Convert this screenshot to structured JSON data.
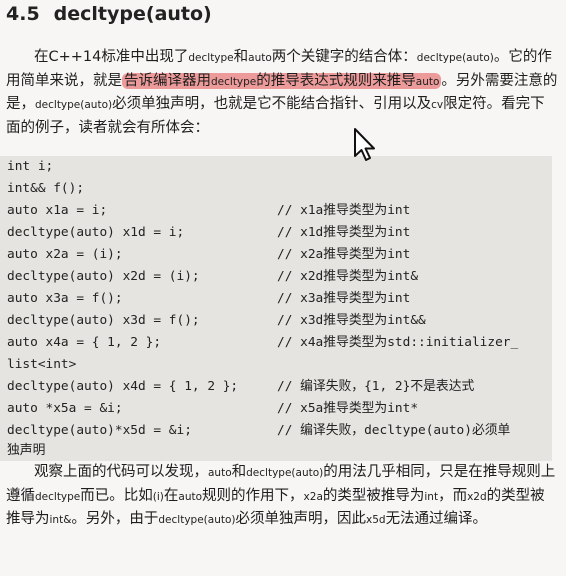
{
  "heading": {
    "number": "4.5",
    "title": "decltype(auto)"
  },
  "para1": {
    "s1": "在C++14标准中出现了",
    "s2": "decltype",
    "s3": "和",
    "s4": "auto",
    "s5": "两个关键字的结合体：",
    "s6": "decltype(auto)",
    "s7": "。它的作用简单来说，就是",
    "hl1": "告诉编译器用",
    "hl2": "decltype",
    "hl3": "的推导表达式规则来推导",
    "hl4": "auto",
    "s8": "。另外需要注意的是，",
    "s9": "decltype(auto)",
    "s10": "必须单独声明，也就是它不能结合指针、引用以及",
    "s11": "cv",
    "s12": "限定符。看完下面的例子，读者就会有所体会："
  },
  "code": [
    {
      "code": "int i;",
      "comment": ""
    },
    {
      "code": "int&& f();",
      "comment": ""
    },
    {
      "code": "auto x1a = i;",
      "comment": "// x1a推导类型为int"
    },
    {
      "code": "decltype(auto) x1d = i;",
      "comment": "// x1d推导类型为int"
    },
    {
      "code": "auto x2a = (i);",
      "comment": "// x2a推导类型为int"
    },
    {
      "code": "decltype(auto) x2d = (i);",
      "comment": "// x2d推导类型为int&"
    },
    {
      "code": "auto x3a = f();",
      "comment": "// x3a推导类型为int"
    },
    {
      "code": "decltype(auto) x3d = f();",
      "comment": "// x3d推导类型为int&&"
    },
    {
      "code": "auto x4a = { 1, 2 };",
      "comment": "// x4a推导类型为std::initializer_"
    },
    {
      "code": "list<int>",
      "comment": ""
    },
    {
      "code": "decltype(auto) x4d = { 1, 2 };",
      "comment": "// 编译失败，{1, 2}不是表达式"
    },
    {
      "code": "auto *x5a = &i;",
      "comment": "// x5a推导类型为int*"
    },
    {
      "code": "decltype(auto)*x5d = &i;",
      "comment": "// 编译失败，decltype(auto)必须单"
    },
    {
      "code": "独声明",
      "comment": ""
    }
  ],
  "para2": {
    "s1": "观察上面的代码可以发现，",
    "s2": "auto",
    "s3": "和",
    "s4": "decltype(auto)",
    "s5": "的用法几乎相同，只是在推导规则上遵循",
    "s6": "decltype",
    "s7": "而已。比如",
    "s8": "(i)",
    "s9": "在",
    "s10": "auto",
    "s11": "规则的作用下，",
    "s12": "x2a",
    "s13": "的类型被推导为",
    "s14": "int",
    "s15": "，而",
    "s16": "x2d",
    "s17": "的类型被推导为",
    "s18": "int&",
    "s19": "。另外，由于",
    "s20": "decltype(auto)",
    "s21": "必须单独声明，因此",
    "s22": "x5d",
    "s23": "无法通过编译。"
  },
  "colors": {
    "highlight": "#e55050",
    "code_bg": "#e6e4e1",
    "page_bg": "#f7f6f4"
  },
  "icons": {
    "cursor": "mouse-pointer-icon"
  }
}
